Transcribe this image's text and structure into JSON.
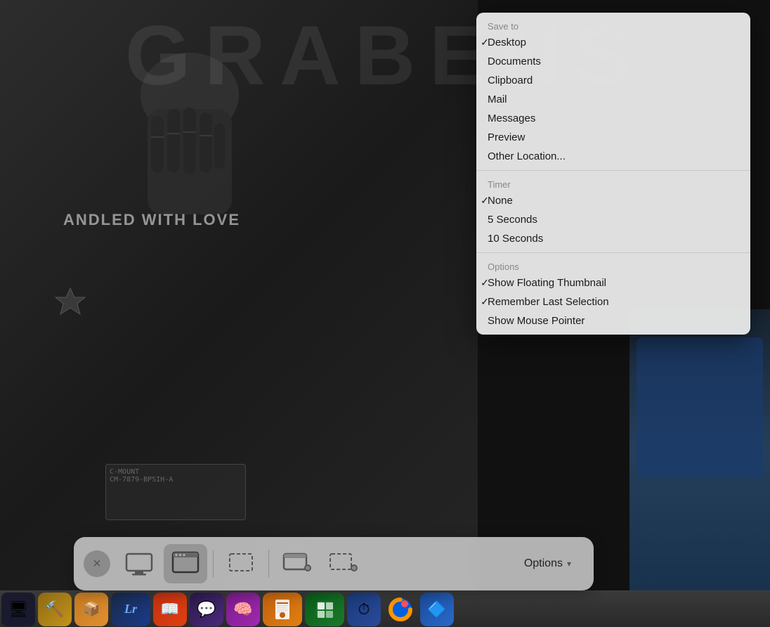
{
  "background": {
    "text": "GRABENS",
    "person_text": "ANDLED WITH LOVE"
  },
  "dropdown": {
    "save_to_header": "Save to",
    "save_items": [
      {
        "id": "desktop",
        "label": "Desktop",
        "checked": true
      },
      {
        "id": "documents",
        "label": "Documents",
        "checked": false
      },
      {
        "id": "clipboard",
        "label": "Clipboard",
        "checked": false
      },
      {
        "id": "mail",
        "label": "Mail",
        "checked": false
      },
      {
        "id": "messages",
        "label": "Messages",
        "checked": false
      },
      {
        "id": "preview",
        "label": "Preview",
        "checked": false
      },
      {
        "id": "other-location",
        "label": "Other Location...",
        "checked": false
      }
    ],
    "timer_header": "Timer",
    "timer_items": [
      {
        "id": "none",
        "label": "None",
        "checked": true
      },
      {
        "id": "5-seconds",
        "label": "5 Seconds",
        "checked": false
      },
      {
        "id": "10-seconds",
        "label": "10 Seconds",
        "checked": false
      }
    ],
    "options_header": "Options",
    "options_items": [
      {
        "id": "show-floating-thumbnail",
        "label": "Show Floating Thumbnail",
        "checked": true
      },
      {
        "id": "remember-last-selection",
        "label": "Remember Last Selection",
        "checked": true
      },
      {
        "id": "show-mouse-pointer",
        "label": "Show Mouse Pointer",
        "checked": false
      }
    ]
  },
  "toolbar": {
    "close_label": "×",
    "options_label": "Options",
    "options_chevron": "▾",
    "buttons": [
      {
        "id": "close",
        "label": "Close"
      },
      {
        "id": "capture-screen",
        "label": "Capture Entire Screen"
      },
      {
        "id": "capture-window",
        "label": "Capture Selected Window"
      },
      {
        "id": "capture-selection",
        "label": "Capture Selection"
      },
      {
        "id": "record-screen",
        "label": "Record Entire Screen"
      },
      {
        "id": "record-selection",
        "label": "Record Selection"
      }
    ]
  },
  "dock": {
    "items": [
      {
        "id": "finder",
        "label": "Finder",
        "emoji": "🖥"
      },
      {
        "id": "xcode",
        "label": "Xcode",
        "emoji": "🔨"
      },
      {
        "id": "box",
        "label": "Box",
        "emoji": "📦"
      },
      {
        "id": "lightroom",
        "label": "Lightroom",
        "emoji": "🔷"
      },
      {
        "id": "books",
        "label": "Books",
        "emoji": "📖"
      },
      {
        "id": "slack",
        "label": "Slack",
        "emoji": "💬"
      },
      {
        "id": "mindnode",
        "label": "MindNode",
        "emoji": "🧠"
      },
      {
        "id": "pages",
        "label": "Pages",
        "emoji": "📄"
      },
      {
        "id": "numbers",
        "label": "Numbers",
        "emoji": "📊"
      },
      {
        "id": "disk-diag",
        "label": "Disk Diag",
        "emoji": "🔵"
      },
      {
        "id": "firefox",
        "label": "Firefox",
        "emoji": "🦊"
      }
    ]
  }
}
